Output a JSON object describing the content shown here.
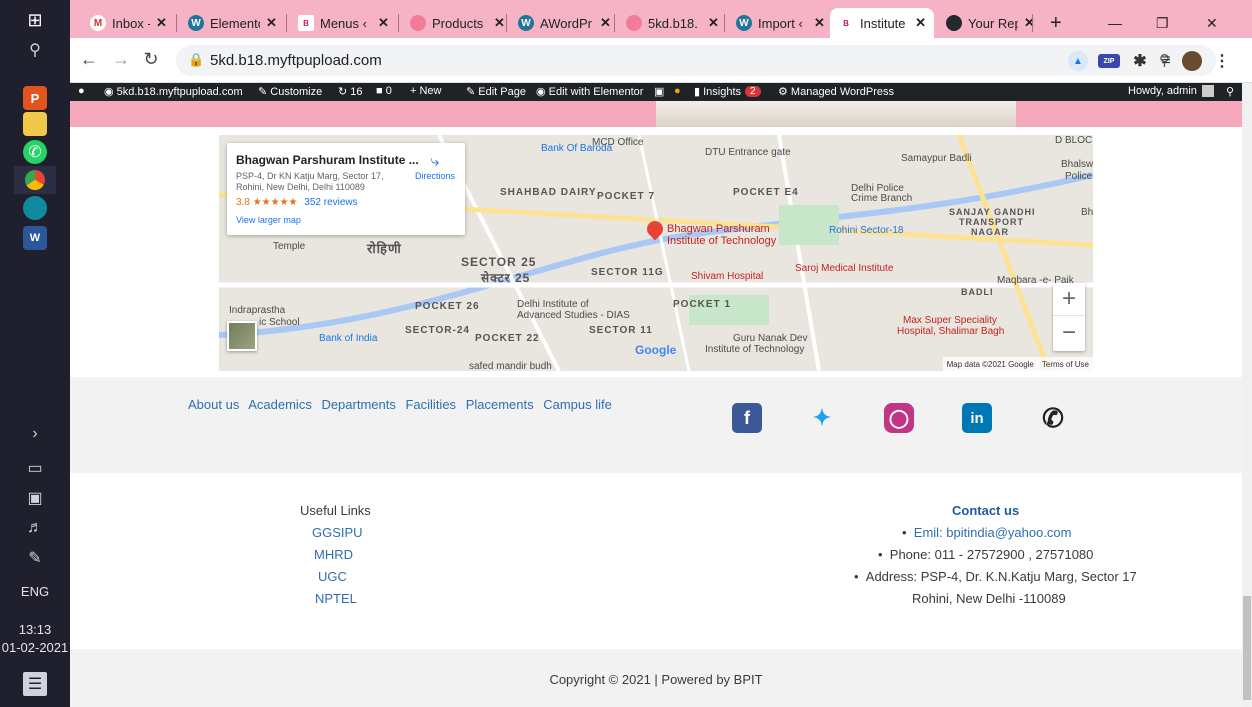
{
  "taskbar": {
    "time": "13:13",
    "date": "01-02-2021",
    "language": "ENG"
  },
  "tabs": [
    {
      "title": "Inbox - a",
      "icon": "gmail-icon",
      "color": "#d93025",
      "glyph": "M"
    },
    {
      "title": "Elemento",
      "icon": "wordpress-icon",
      "color": "#21759b",
      "glyph": "W"
    },
    {
      "title": "Menus ‹",
      "icon": "bpit-icon",
      "color": "#c2185b",
      "glyph": "B"
    },
    {
      "title": "Products",
      "icon": "elementor-icon",
      "color": "#f27b9a",
      "glyph": "G"
    },
    {
      "title": "AWordPr",
      "icon": "wordpress-icon",
      "color": "#21759b",
      "glyph": "W"
    },
    {
      "title": "5kd.b18.",
      "icon": "elementor-icon",
      "color": "#f27b9a",
      "glyph": "G"
    },
    {
      "title": "Import ‹",
      "icon": "wordpress-icon",
      "color": "#21759b",
      "glyph": "W"
    },
    {
      "title": "Institute",
      "icon": "bpit-icon",
      "color": "#c2185b",
      "glyph": "B"
    },
    {
      "title": "Your Rep",
      "icon": "github-icon",
      "color": "#24292e",
      "glyph": "G"
    }
  ],
  "browser": {
    "url": "5kd.b18.myftpupload.com",
    "new_tab": "+"
  },
  "adminbar": {
    "site": "5kd.b18.myftpupload.com",
    "customize": "Customize",
    "updates": "16",
    "comments": "0",
    "new": "New",
    "edit_page": "Edit Page",
    "edit_elementor": "Edit with Elementor",
    "insights": "Insights",
    "insights_count": "2",
    "managed": "Managed WordPress",
    "howdy": "Howdy, admin"
  },
  "map": {
    "place_name": "Bhagwan Parshuram Institute ...",
    "address_line1": "PSP-4, Dr KN Katju Marg, Sector 17,",
    "address_line2": "Rohini, New Delhi, Delhi 110089",
    "rating": "3.8",
    "stars": "★★★★★",
    "reviews": "352 reviews",
    "directions": "Directions",
    "view_larger": "View larger map",
    "pin_label_1": "Bhagwan Parshuram",
    "pin_label_2": "Institute of Technology",
    "attribution": "Map data ©2021 Google",
    "terms": "Terms of Use",
    "google": "Google",
    "labels": {
      "mcd": "MCD Office",
      "bob": "Bank Of Baroda",
      "dtu": "DTU Entrance gate",
      "samaypur": "Samaypur Badli",
      "bhalsw": "Bhalsw",
      "police": "Police",
      "dbloc": "D BLOC",
      "shahbad": "SHAHBAD DAIRY",
      "pocket7": "POCKET 7",
      "pocketE4": "POCKET E4",
      "crime1": "Delhi Police",
      "crime2": "Crime Branch",
      "sanjay1": "SANJAY GANDHI",
      "sanjay2": "TRANSPORT",
      "sanjay3": "NAGAR",
      "bh": "Bh",
      "rohini": "रोहिणी",
      "temple": "Temple",
      "rohini18": "Rohini Sector-18",
      "sector25a": "SECTOR 25",
      "sector25b": "सेक्टर 25",
      "sector11g": "SECTOR 11G",
      "shivam": "Shivam Hospital",
      "saroj": "Saroj Medical Institute",
      "maqbara": "Maqbara -e- Paik",
      "badli": "BADLI",
      "indraprastha": "Indraprastha",
      "school": "ic School",
      "pocket26": "POCKET 26",
      "dias1": "Delhi Institute of",
      "dias2": "Advanced Studies - DIAS",
      "pocket1": "POCKET 1",
      "maxsuper1": "Max Super Speciality",
      "maxsuper2": "Hospital, Shalimar Bagh",
      "boi": "Bank of India",
      "sector24": "SECTOR-24",
      "pocket22": "POCKET 22",
      "sector11": "SECTOR 11",
      "gurunanak1": "Guru Nanak Dev",
      "gurunanak2": "Institute of Technology",
      "safed": "safed mandir budh"
    }
  },
  "footer_nav": {
    "links": [
      "About us",
      "Academics",
      "Departments",
      "Facilities",
      "Placements",
      "Campus life"
    ]
  },
  "useful_links": {
    "title": "Useful Links",
    "items": [
      "GGSIPU",
      "MHRD",
      "UGC",
      "NPTEL"
    ]
  },
  "contact": {
    "title": "Contact us",
    "email": "Emil: bpitindia@yahoo.com",
    "phone": "Phone: 011 - 27572900 , 27571080",
    "address1": "Address: PSP-4, Dr. K.N.Katju Marg, Sector 17",
    "address2": "Rohini, New Delhi -110089"
  },
  "copyright": "Copyright © 2021 | Powered by BPIT",
  "colors": {
    "pink": "#f6a8bd",
    "link": "#2e6fb0",
    "facebook": "#3b5998",
    "twitter": "#1da1f2",
    "instagram": "#c13584",
    "linkedin": "#0077b5"
  }
}
